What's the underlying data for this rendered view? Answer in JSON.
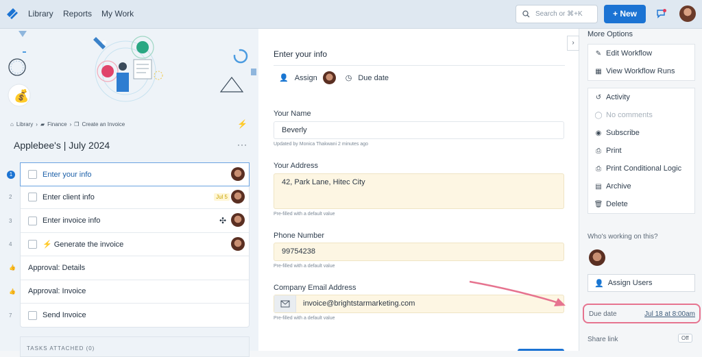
{
  "topbar": {
    "nav": [
      "Library",
      "Reports",
      "My Work"
    ],
    "search_placeholder": "Search or ⌘+K",
    "new_label": "+ New",
    "colors": {
      "bar": "#dfe8f1",
      "accent": "#1b73d3"
    }
  },
  "left": {
    "breadcrumb": [
      "Library",
      "Finance",
      "Create an Invoice"
    ],
    "title": "Applebee's | July 2024",
    "tasks": [
      {
        "num": "1",
        "label": "Enter your info",
        "active": true,
        "checkbox": true
      },
      {
        "num": "2",
        "label": "Enter client info",
        "badge": "Jul 5",
        "checkbox": true
      },
      {
        "num": "3",
        "label": "Enter invoice info",
        "checkbox": true
      },
      {
        "num": "4",
        "label": "⚡ Generate the invoice",
        "checkbox": true
      },
      {
        "num": "",
        "label": "Approval: Details",
        "checkbox": false
      },
      {
        "num": "",
        "label": "Approval: Invoice",
        "checkbox": false
      },
      {
        "num": "7",
        "label": "Send Invoice",
        "checkbox": true
      }
    ],
    "tasks_attached": "TASKS ATTACHED (0)"
  },
  "form": {
    "title": "Enter your info",
    "assign_label": "Assign",
    "due_date_label": "Due date",
    "fields": [
      {
        "label": "Your Name",
        "value": "Beverly",
        "hint": "Updated by Monica Thakwani 2 minutes ago"
      },
      {
        "label": "Your Address",
        "value": "42, Park Lane, Hitec City",
        "hint": "Pre-filled with a default value"
      },
      {
        "label": "Phone Number",
        "value": "99754238",
        "hint": "Pre-filled with a default value"
      },
      {
        "label": "Company Email Address",
        "value": "invoice@brightstarmarketing.com",
        "hint": "Pre-filled with a default value"
      }
    ]
  },
  "right": {
    "more_options": "More Options",
    "menu1": [
      {
        "icon": "edit-icon",
        "label": "Edit Workflow"
      },
      {
        "icon": "table-icon",
        "label": "View Workflow Runs"
      }
    ],
    "menu2": [
      {
        "icon": "history-icon",
        "label": "Activity"
      },
      {
        "icon": "comment-icon",
        "label": "No comments",
        "disabled": true
      },
      {
        "icon": "eye-icon",
        "label": "Subscribe"
      },
      {
        "icon": "print-icon",
        "label": "Print"
      },
      {
        "icon": "print-icon",
        "label": "Print Conditional Logic"
      },
      {
        "icon": "archive-icon",
        "label": "Archive"
      },
      {
        "icon": "trash-icon",
        "label": "Delete"
      }
    ],
    "who_working": "Who's working on this?",
    "assign_users": "Assign Users",
    "due_date_label": "Due date",
    "due_date_value": "Jul 18 at 8:00am",
    "share_link": "Share link",
    "share_toggle": "Off",
    "highlight_color": "#e6738f"
  }
}
